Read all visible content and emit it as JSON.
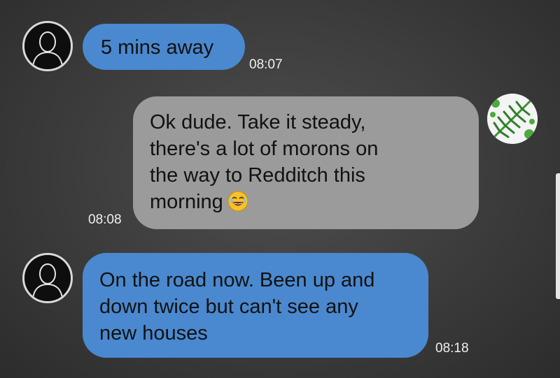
{
  "messages": [
    {
      "direction": "outgoing",
      "text": "5 mins away",
      "time": "08:07",
      "avatar_icon": "default-user-icon"
    },
    {
      "direction": "incoming",
      "line1": "Ok dude. Take it steady,",
      "line2": "there's a lot of morons on",
      "line3": "the way to Redditch this",
      "line4": "morning",
      "emoji": "laughing-emoji-icon",
      "time": "08:08",
      "avatar_icon": "fern-avatar-icon"
    },
    {
      "direction": "outgoing",
      "line1": "On the road now. Been up and",
      "line2": "down twice but can't see any",
      "line3": "new houses",
      "time": "08:18",
      "avatar_icon": "default-user-icon"
    }
  ],
  "colors": {
    "outgoing_bubble": "#4a89cf",
    "incoming_bubble": "#9b9b9b",
    "background": "#3f3f3f",
    "timestamp": "#f0f0f0"
  }
}
